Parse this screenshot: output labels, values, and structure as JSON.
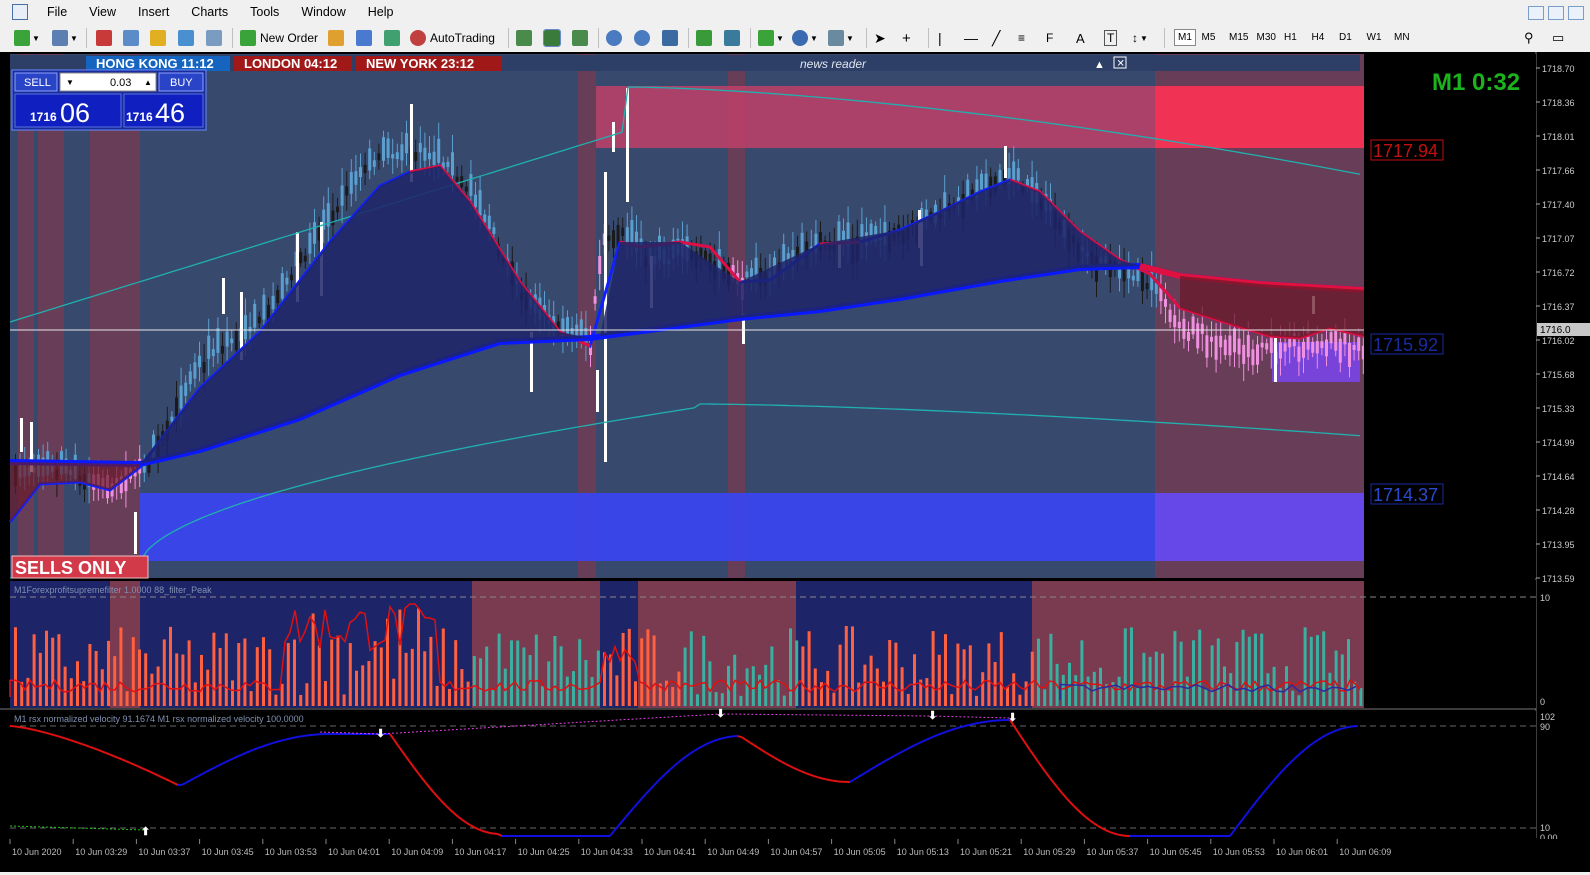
{
  "menu": [
    "File",
    "View",
    "Insert",
    "Charts",
    "Tools",
    "Window",
    "Help"
  ],
  "toolbar": {
    "new_order": "New Order",
    "autotrading": "AutoTrading",
    "timeframes": [
      "M1",
      "M5",
      "M15",
      "M30",
      "H1",
      "H4",
      "D1",
      "W1",
      "MN"
    ],
    "active_timeframe": "M1"
  },
  "sessions": [
    {
      "label": "HONG KONG 11:12",
      "color": "#1565c0"
    },
    {
      "label": "LONDON  04:12",
      "color": "#a01818"
    },
    {
      "label": "NEW YORK 23:12",
      "color": "#a01818"
    }
  ],
  "news_reader": "news reader",
  "trade_panel": {
    "sell_label": "SELL",
    "buy_label": "BUY",
    "lot": "0.03",
    "sell_big": "1716",
    "sell_small": "06",
    "buy_big": "1716",
    "buy_small": "46"
  },
  "timer": "M1 0:32",
  "sells_only": "SELLS ONLY",
  "level_labels": {
    "resistance": "1717.94",
    "current": "1715.92",
    "support": "1714.37"
  },
  "current_price_tag": "1716.0",
  "price_axis": [
    "1718.70",
    "1718.36",
    "1718.01",
    "1717.66",
    "1717.40",
    "1717.07",
    "1716.72",
    "1716.37",
    "1716.02",
    "1715.68",
    "1715.33",
    "1714.99",
    "1714.64",
    "1714.28",
    "1713.95",
    "1713.59"
  ],
  "indicator1": {
    "title": "M1Forexprofitsupremefilter 1.0000  88_filter_Peak",
    "axis": [
      "10",
      "0"
    ]
  },
  "indicator2": {
    "title": "M1 rsx normalized  velocity 91.1674  M1 rsx normalized velocity 100.0000",
    "axis": [
      "102",
      "90",
      "10",
      "0.00"
    ]
  },
  "time_axis": [
    "10 Jun 2020",
    "10 Jun 03:29",
    "10 Jun 03:37",
    "10 Jun 03:45",
    "10 Jun 03:53",
    "10 Jun 04:01",
    "10 Jun 04:09",
    "10 Jun 04:17",
    "10 Jun 04:25",
    "10 Jun 04:33",
    "10 Jun 04:41",
    "10 Jun 04:49",
    "10 Jun 04:57",
    "10 Jun 05:05",
    "10 Jun 05:13",
    "10 Jun 05:21",
    "10 Jun 05:29",
    "10 Jun 05:37",
    "10 Jun 05:45",
    "10 Jun 05:53",
    "10 Jun 06:01",
    "10 Jun 06:09"
  ],
  "colors": {
    "bull": "#5b9fcf",
    "bear": "#1a1a1a",
    "sell_candle": "#f090e0",
    "accent_green": "#1db31d",
    "uptrend": "#1020ff",
    "downtrend": "#e01040"
  }
}
